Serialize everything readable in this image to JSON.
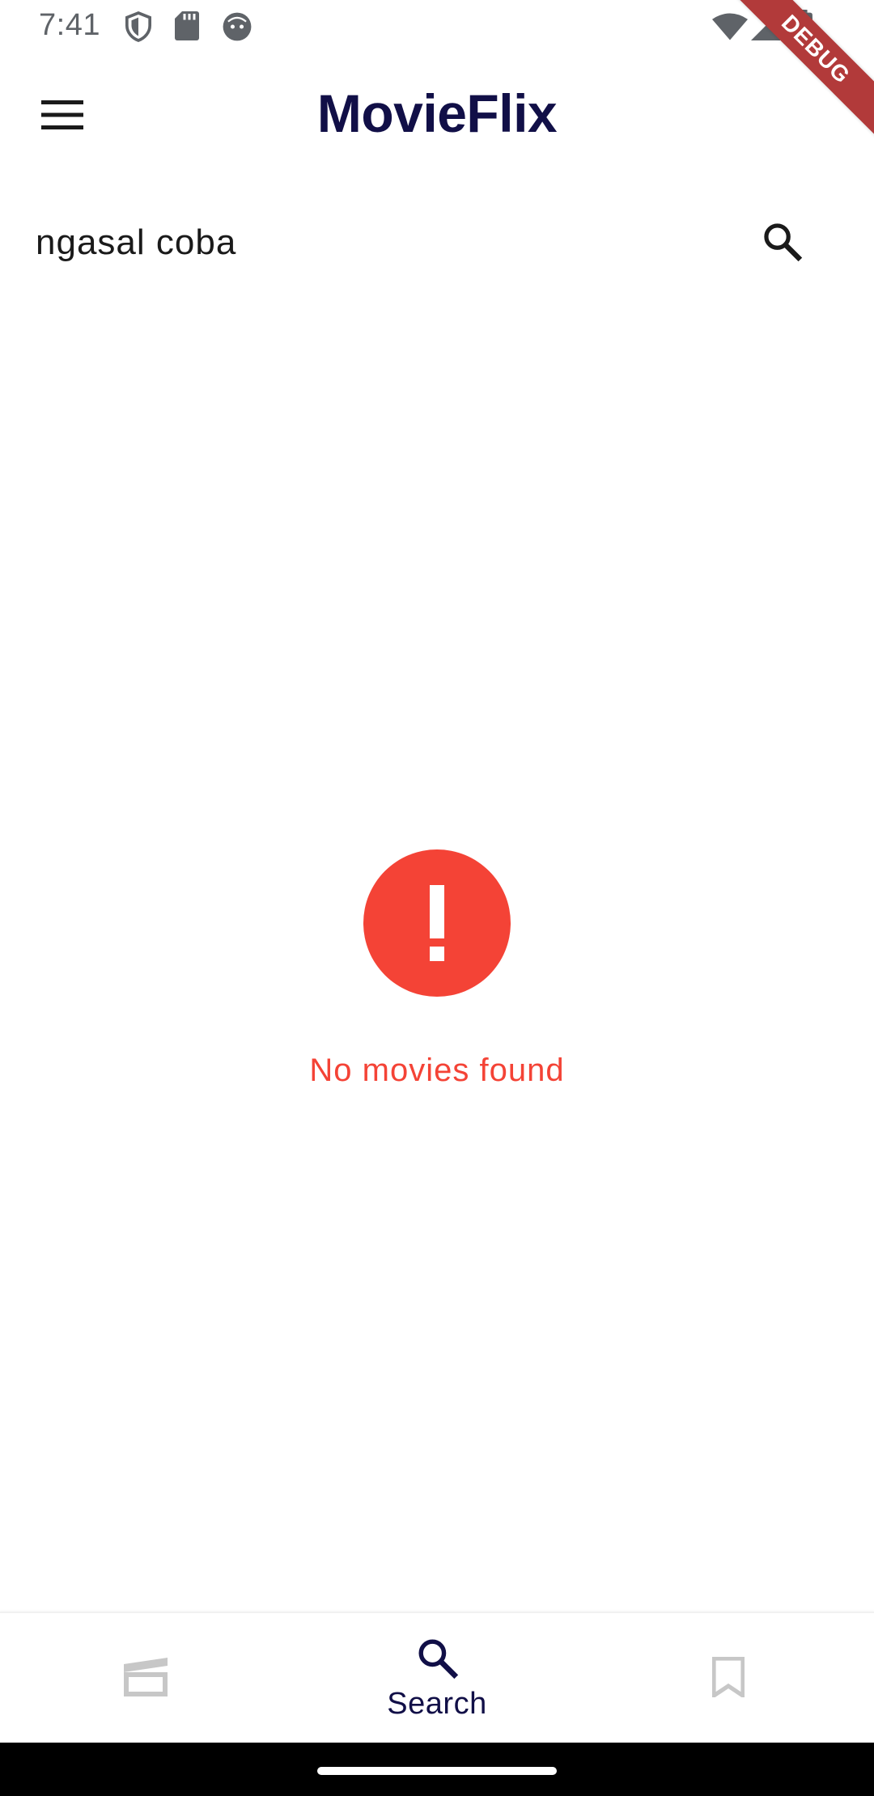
{
  "status_bar": {
    "time": "7:41",
    "left_icons": [
      "shield-icon",
      "sd-card-icon",
      "android-face-icon"
    ],
    "right_icons": [
      "wifi-icon",
      "signal-icon",
      "battery-icon"
    ]
  },
  "debug_banner": {
    "label": "DEBUG",
    "color": "#b23a3a"
  },
  "app_bar": {
    "title": "MovieFlix",
    "menu_icon": "menu-icon",
    "title_color": "#110f47"
  },
  "search": {
    "value": "ngasal coba",
    "button_icon": "search-icon"
  },
  "error_state": {
    "icon": "error-circle-icon",
    "message": "No movies found",
    "color": "#f44336"
  },
  "bottom_nav": {
    "items": [
      {
        "icon": "movie-clapper-icon",
        "label": "",
        "active": false
      },
      {
        "icon": "search-icon",
        "label": "Search",
        "active": true
      },
      {
        "icon": "bookmark-icon",
        "label": "",
        "active": false
      }
    ],
    "active_color": "#110f47",
    "inactive_color": "#c7c7c7"
  }
}
